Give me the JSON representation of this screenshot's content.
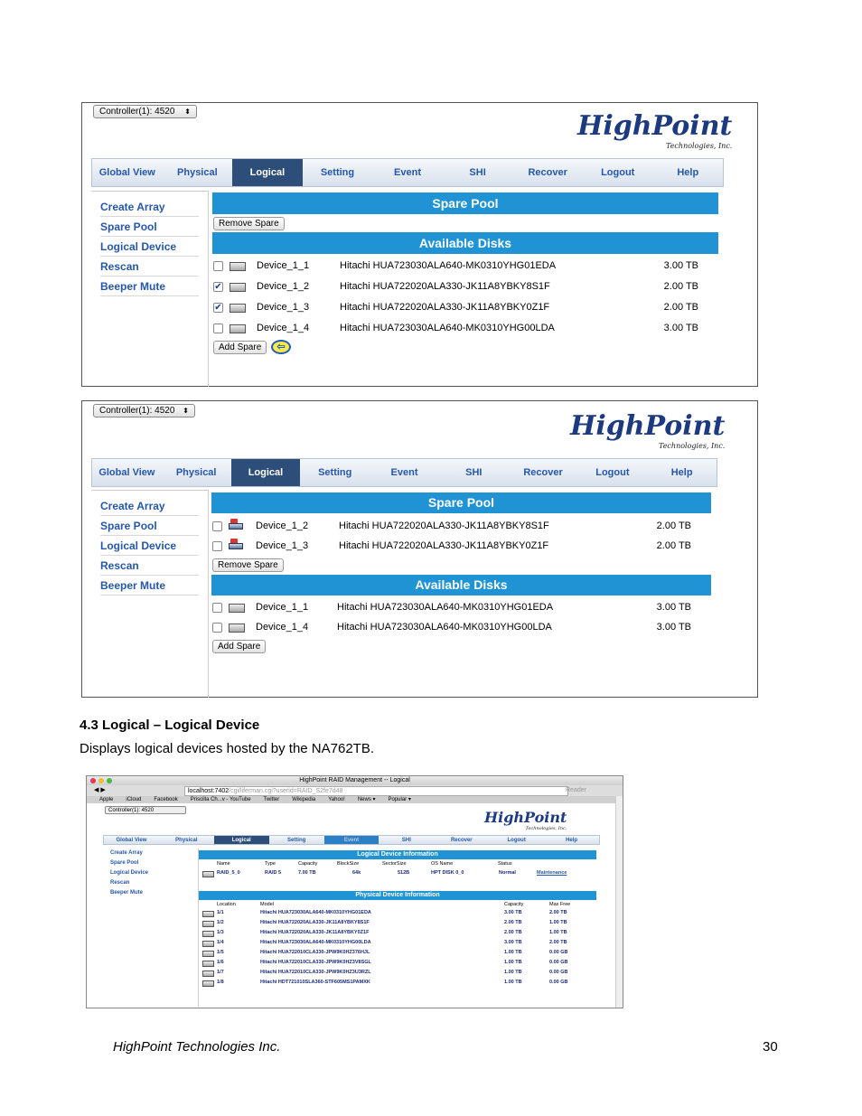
{
  "screenshot1": {
    "controller": "Controller(1): 4520",
    "logo_main": "HighPoint",
    "logo_sub": "Technologies, Inc.",
    "nav": [
      "Global View",
      "Physical",
      "Logical",
      "Setting",
      "Event",
      "SHI",
      "Recover",
      "Logout",
      "Help"
    ],
    "active_nav": "Logical",
    "sidebar": [
      "Create Array",
      "Spare Pool",
      "Logical Device",
      "Rescan",
      "Beeper Mute"
    ],
    "spare_pool_title": "Spare Pool",
    "remove_spare": "Remove Spare",
    "available_title": "Available Disks",
    "disks": [
      {
        "name": "Device_1_1",
        "model": "Hitachi HUA723030ALA640-MK0310YHG01EDA",
        "capacity": "3.00 TB",
        "checked": false
      },
      {
        "name": "Device_1_2",
        "model": "Hitachi HUA722020ALA330-JK11A8YBKY8S1F",
        "capacity": "2.00 TB",
        "checked": true
      },
      {
        "name": "Device_1_3",
        "model": "Hitachi HUA722020ALA330-JK11A8YBKY0Z1F",
        "capacity": "2.00 TB",
        "checked": true
      },
      {
        "name": "Device_1_4",
        "model": "Hitachi HUA723030ALA640-MK0310YHG00LDA",
        "capacity": "3.00 TB",
        "checked": false
      }
    ],
    "add_spare": "Add Spare"
  },
  "screenshot2": {
    "controller": "Controller(1): 4520",
    "logo_main": "HighPoint",
    "logo_sub": "Technologies, Inc.",
    "nav": [
      "Global View",
      "Physical",
      "Logical",
      "Setting",
      "Event",
      "SHI",
      "Recover",
      "Logout",
      "Help"
    ],
    "sidebar": [
      "Create Array",
      "Spare Pool",
      "Logical Device",
      "Rescan",
      "Beeper Mute"
    ],
    "spare_pool_title": "Spare Pool",
    "spares": [
      {
        "name": "Device_1_2",
        "model": "Hitachi HUA722020ALA330-JK11A8YBKY8S1F",
        "capacity": "2.00 TB"
      },
      {
        "name": "Device_1_3",
        "model": "Hitachi HUA722020ALA330-JK11A8YBKY0Z1F",
        "capacity": "2.00 TB"
      }
    ],
    "remove_spare": "Remove Spare",
    "available_title": "Available Disks",
    "disks": [
      {
        "name": "Device_1_1",
        "model": "Hitachi HUA723030ALA640-MK0310YHG01EDA",
        "capacity": "3.00 TB"
      },
      {
        "name": "Device_1_4",
        "model": "Hitachi HUA723030ALA640-MK0310YHG00LDA",
        "capacity": "3.00 TB"
      }
    ],
    "add_spare": "Add Spare"
  },
  "section": {
    "heading": "4.3 Logical – Logical Device",
    "text": "Displays logical devices hosted by the NA762TB."
  },
  "screenshot3": {
    "window_title": "HighPoint RAID Management -- Logical",
    "url_host": "localhost:7402",
    "url_path": "/cgi/liferman.cgi?userid=RAID_S2fe7d48",
    "reader": "Reader",
    "bookmarks": [
      "Apple",
      "iCloud",
      "Facebook",
      "Priscilla Ch...v - YouTube",
      "Twitter",
      "Wikipedia",
      "Yahoo!",
      "News ▾",
      "Popular ▾"
    ],
    "controller": "Controller(1): 4520",
    "logo_main": "HighPoint",
    "logo_sub": "Technologies, Inc.",
    "nav": [
      "Global View",
      "Physical",
      "Logical",
      "Setting",
      "Event",
      "SHI",
      "Recover",
      "Logout",
      "Help"
    ],
    "sidebar": [
      "Create Array",
      "Spare Pool",
      "Logical Device",
      "Rescan",
      "Beeper Mute"
    ],
    "ld_title": "Logical Device Information",
    "ld_headers": [
      "Name",
      "Type",
      "Capacity",
      "BlockSize",
      "SectorSize",
      "OS Name",
      "Status"
    ],
    "ld_row": [
      "RAID_5_0",
      "RAID 5",
      "7.00 TB",
      "64k",
      "512B",
      "HPT DISK 0_0",
      "Normal",
      "Maintenance"
    ],
    "pd_title": "Physical Device Information",
    "pd_headers": [
      "Location",
      "Model",
      "Capacity",
      "Max Free"
    ],
    "pd_rows": [
      [
        "1/1",
        "Hitachi HUA723030ALA640-MK0310YHG01EDA",
        "3.00 TB",
        "2.00 TB"
      ],
      [
        "1/2",
        "Hitachi HUA722020ALA330-JK11A8YBKY8S1F",
        "2.00 TB",
        "1.00 TB"
      ],
      [
        "1/3",
        "Hitachi HUA722020ALA330-JK11A8YBKY0Z1F",
        "2.00 TB",
        "1.00 TB"
      ],
      [
        "1/4",
        "Hitachi HUA723030ALA640-MK0310YHG00LDA",
        "3.00 TB",
        "2.00 TB"
      ],
      [
        "1/5",
        "Hitachi HUA722010CLA330-JPW9K0HZ376HJL",
        "1.00 TB",
        "0.00 GB"
      ],
      [
        "1/6",
        "Hitachi HUA722010CLA330-JPW9K0HZ3V8SGL",
        "1.00 TB",
        "0.00 GB"
      ],
      [
        "1/7",
        "Hitachi HUA722010CLA330-JPW9K0HZ3U3RZL",
        "1.00 TB",
        "0.00 GB"
      ],
      [
        "1/8",
        "Hitachi HDT721010SLA360-STF605MS1PAMXK",
        "1.00 TB",
        "0.00 GB"
      ]
    ]
  },
  "footer": {
    "company": "HighPoint Technologies Inc.",
    "page": "30"
  }
}
